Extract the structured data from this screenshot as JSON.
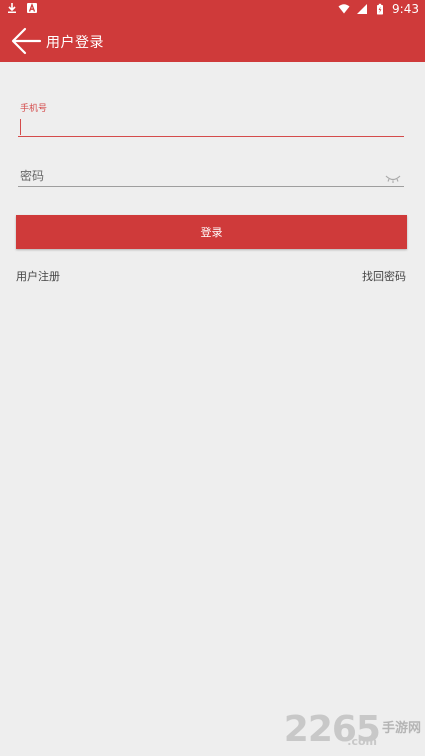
{
  "status_bar": {
    "time": "9:43",
    "left_icons": [
      "download-icon",
      "notification-a-icon"
    ],
    "right_icons": [
      "wifi-icon",
      "signal-icon",
      "battery-icon"
    ]
  },
  "app_bar": {
    "title": "用户登录",
    "back_icon": "back-arrow-icon"
  },
  "form": {
    "phone_label": "手机号",
    "phone_value": "",
    "password_placeholder": "密码",
    "password_toggle_icon": "eye-closed-icon",
    "login_label": "登录"
  },
  "links": {
    "register": "用户注册",
    "forgot": "找回密码"
  },
  "watermark": {
    "number": "2265",
    "suffix": "手游网",
    "domain": ".com"
  },
  "colors": {
    "primary": "#cf3a3a",
    "background": "#eeeeee",
    "label_active": "#d44b4b"
  }
}
